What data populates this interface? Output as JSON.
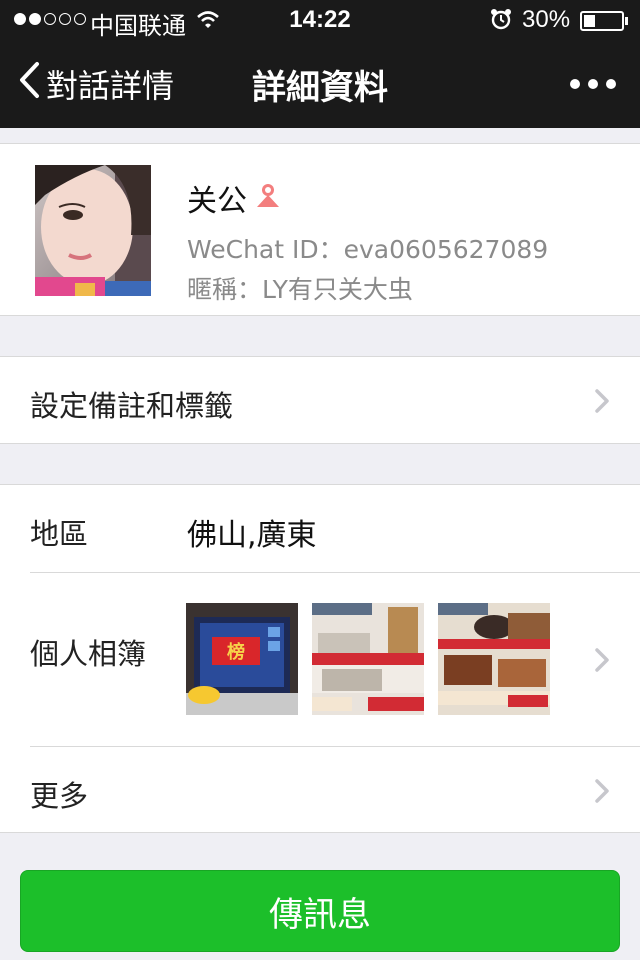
{
  "status_bar": {
    "carrier": "中国联通",
    "time": "14:22",
    "battery_percent": "30%",
    "battery_level": 0.3,
    "signal_strength": 2
  },
  "nav": {
    "back_label": "對話詳情",
    "title": "詳細資料"
  },
  "profile": {
    "name": "关公",
    "wechat_id": "WeChat ID：eva0605627089",
    "nickname": "暱稱：LY有只关大虫",
    "gender_icon": "female-icon",
    "gender_color": "#f37e7e"
  },
  "remark": {
    "label": "設定備註和標籤"
  },
  "info": {
    "region_label": "地區",
    "region_value": "佛山,廣東",
    "album_label": "個人相簿",
    "more_label": "更多"
  },
  "send_button": {
    "label": "傳訊息",
    "color": "#1cbf2a"
  }
}
